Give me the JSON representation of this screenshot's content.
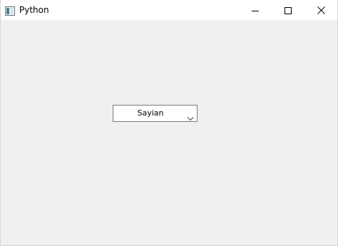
{
  "window": {
    "title": "Python",
    "icon": "python-app-icon",
    "controls": {
      "minimize": "minimize-icon",
      "maximize": "maximize-icon",
      "close": "close-icon"
    }
  },
  "combobox": {
    "selected": "Sayian",
    "arrow_icon": "chevron-down-icon"
  },
  "colors": {
    "titlebar": "#ffffff",
    "client_area": "#f0f0f0",
    "combo_border": "#7a7a7a"
  }
}
